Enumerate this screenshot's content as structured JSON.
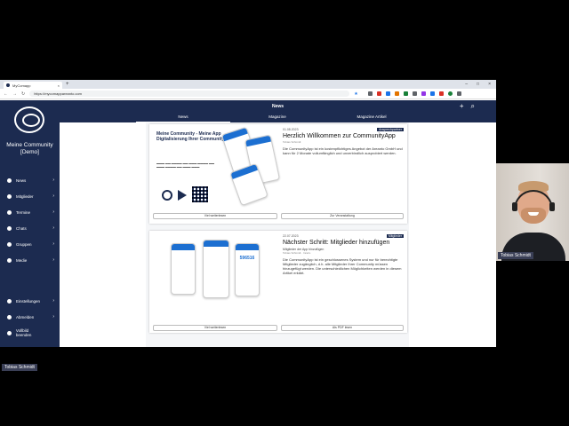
{
  "browser": {
    "tab_title": "MyComapp",
    "url": "https://mycomappareanto.com",
    "new_tab": "+"
  },
  "sidebar": {
    "community_name": "Meine Community [Demo]",
    "items": [
      {
        "label": "News",
        "icon": "news-icon"
      },
      {
        "label": "Mitglieder",
        "icon": "members-icon"
      },
      {
        "label": "Termine",
        "icon": "calendar-icon"
      },
      {
        "label": "Chats",
        "icon": "chat-icon"
      },
      {
        "label": "Gruppen",
        "icon": "groups-icon"
      },
      {
        "label": "Medie",
        "icon": "media-icon"
      }
    ],
    "bottom": [
      {
        "label": "Einstellungen",
        "icon": "settings-icon"
      },
      {
        "label": "Abmelden",
        "icon": "logout-icon"
      },
      {
        "label": "Vollbild beenden",
        "icon": "fullscreen-icon"
      }
    ]
  },
  "header": {
    "title": "News",
    "tabs": [
      "News",
      "Magazine",
      "Magazine Artikel"
    ]
  },
  "posts": [
    {
      "date": "01.08.2023",
      "badge": "Ansprechpartner",
      "title": "Herzlich Willkommen zur CommunityApp",
      "author": "Tobias Schmidt",
      "text": "Die CommunityApp ist ein kostenpflichtiges Angebot der Areanto GmbH und kann für 2 Monate vollumfänglich und unverbindlich ausprobiert werden.",
      "image_title": "Meine Community - Meine App Digitalisierung Ihrer Community",
      "btn_left": "Viel weiterlesen",
      "btn_right": "Zur Veranstaltung"
    },
    {
      "date": "22.07.2023",
      "badge": "Mitglieder",
      "title": "Nächster Schritt: Mitglieder hinzufügen",
      "subtitle": "Mitglieder der App hinzufügen",
      "author": "Tobias Schmidt · Inrazu",
      "text": "Die CommunityApp ist ein geschlossenes System und nur für berechtigte Mitglieder zugänglich, d.h. alle Mitglieder Ihrer Community müssen hinzugefügt werden. Die unterschiedlichen Möglichkeiten werden in diesem Artikel erklärt.",
      "image_number": "596516",
      "btn_left": "Viel weiterlesen",
      "btn_right": "Als PDF lesen"
    }
  ],
  "video": {
    "remote_name": "Tobias Schmidt",
    "self_name": "Tobias Schmidt"
  },
  "colors": {
    "brand": "#1c2b50",
    "accent": "#1c6fd1"
  }
}
